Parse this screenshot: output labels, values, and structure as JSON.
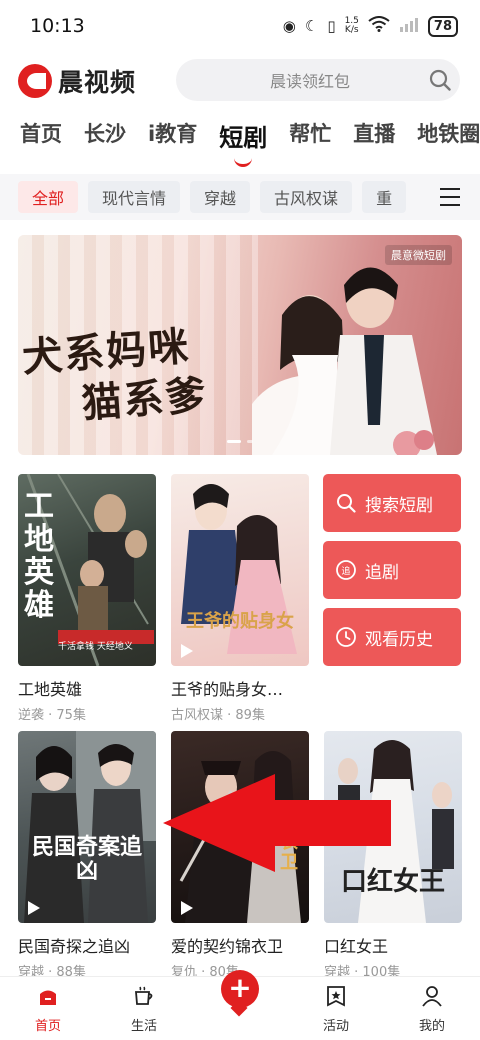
{
  "status_bar": {
    "time": "10:13",
    "speed_value": "1.5",
    "speed_unit": "K/s",
    "battery": "78"
  },
  "header": {
    "brand": "晨视频",
    "search_placeholder": "晨读领红包"
  },
  "main_nav": {
    "items": [
      "首页",
      "长沙",
      "i教育",
      "短剧",
      "帮忙",
      "直播",
      "地铁圈"
    ],
    "active": "短剧"
  },
  "subtags": {
    "items": [
      "全部",
      "现代言情",
      "穿越",
      "古风权谋",
      "重"
    ],
    "active": "全部"
  },
  "banner": {
    "title_line1": "犬系妈咪",
    "title_line2": "猫系爹",
    "brand": "晨意微短剧"
  },
  "cards_row1": [
    {
      "title": "工地英雄",
      "meta": "逆袭 · 75集",
      "poster_text": "工地英雄",
      "poster_tag": "千活拿钱 天经地义"
    },
    {
      "title": "王爷的贴身女…",
      "meta": "古风权谋 · 89集",
      "poster_text": "王爷的贴身女"
    }
  ],
  "actions": [
    {
      "label": "搜索短剧",
      "icon": "search-icon"
    },
    {
      "label": "追剧",
      "icon": "follow-icon"
    },
    {
      "label": "观看历史",
      "icon": "clock-icon"
    }
  ],
  "cards_row2": [
    {
      "title": "民国奇探之追凶",
      "meta": "穿越 · 88集",
      "poster_text": "民国奇案追凶"
    },
    {
      "title": "爱的契约锦衣卫",
      "meta": "复仇 · 80集",
      "poster_text": "锦衣卫"
    },
    {
      "title": "口红女王",
      "meta": "穿越 · 100集",
      "poster_text": "口红女王"
    }
  ],
  "bottom_nav": {
    "items": [
      "首页",
      "生活",
      "活动",
      "我的"
    ],
    "active": "首页"
  },
  "colors": {
    "brand_red": "#e02020",
    "action_red": "#ed5858"
  }
}
